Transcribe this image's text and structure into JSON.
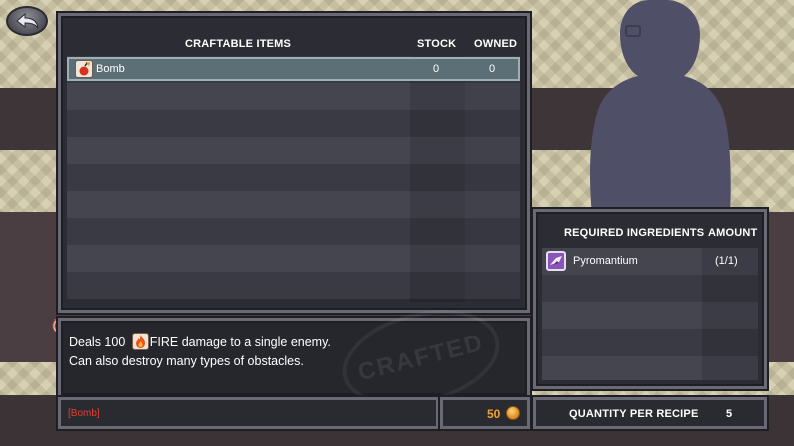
{
  "craft_table": {
    "headers": {
      "item": "CRAFTABLE ITEMS",
      "stock": "STOCK",
      "owned": "OWNED"
    },
    "rows": [
      {
        "name": "Bomb",
        "stock": "0",
        "owned": "0",
        "icon": "bomb-icon",
        "selected": true
      }
    ]
  },
  "ingredients_table": {
    "headers": {
      "ingredient": "REQUIRED INGREDIENTS",
      "amount": "AMOUNT"
    },
    "rows": [
      {
        "name": "Pyromantium",
        "amount": "(1/1)",
        "icon": "pyromantium-icon"
      }
    ]
  },
  "description": {
    "line1_prefix": "Deals 100",
    "line1_suffix": "FIRE damage to a single enemy.",
    "line2": "Can also destroy many types of obstacles.",
    "element_icon": "fire-icon",
    "stamp": "CRAFTED"
  },
  "footer": {
    "item_name": "[Bomb]",
    "cost": "50",
    "cost_icon": "coin-icon",
    "quantity_label": "QUANTITY PER RECIPE",
    "quantity_value": "5"
  },
  "colors": {
    "selected_row": "#5d6f76",
    "item_name_red": "#e2412f",
    "cost_gold": "#f0a432",
    "panel_bg": "#2c2c34"
  }
}
